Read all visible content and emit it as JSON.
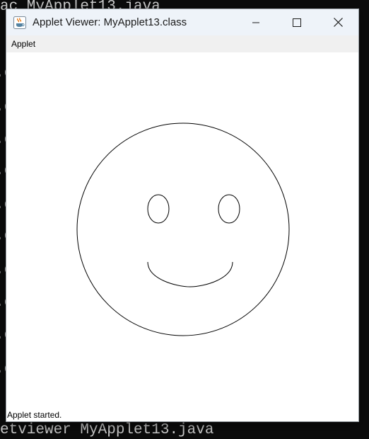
{
  "terminal": {
    "top_text": "ac MyApplet13.java",
    "bottom_text": "etviewer MyApplet13.java",
    "edge_fragment": ".c"
  },
  "window": {
    "title": "Applet Viewer: MyApplet13.class",
    "app_icon": "java-cup-icon",
    "controls": [
      "minimize-icon",
      "maximize-icon",
      "close-icon"
    ],
    "menu": [
      "Applet"
    ],
    "status": "Applet started."
  },
  "drawing": {
    "shapes": [
      "face-circle",
      "left-eye",
      "right-eye",
      "smile-arc"
    ],
    "stroke_color": "#000000"
  }
}
